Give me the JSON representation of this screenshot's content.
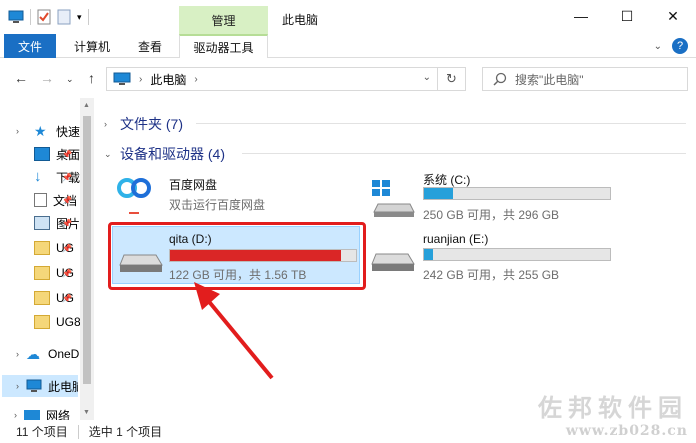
{
  "window": {
    "title": "此电脑",
    "context_tab_group": "管理"
  },
  "ribbon": {
    "tabs": [
      "文件",
      "计算机",
      "查看",
      "驱动器工具"
    ]
  },
  "address": {
    "crumb": "此电脑",
    "search_placeholder": "搜索\"此电脑\""
  },
  "nav": {
    "items": [
      {
        "label": "快速访问",
        "icon": "star-icon"
      },
      {
        "label": "桌面",
        "icon": "desktop-icon"
      },
      {
        "label": "下载",
        "icon": "download-icon"
      },
      {
        "label": "文档",
        "icon": "document-icon"
      },
      {
        "label": "图片",
        "icon": "pictures-icon"
      },
      {
        "label": "UG",
        "icon": "folder-icon"
      },
      {
        "label": "UG",
        "icon": "folder-icon"
      },
      {
        "label": "UG",
        "icon": "folder-icon"
      },
      {
        "label": "UG8",
        "icon": "folder-icon"
      },
      {
        "label": "OneDrive",
        "icon": "cloud-icon"
      },
      {
        "label": "此电脑",
        "icon": "computer-icon"
      },
      {
        "label": "网络",
        "icon": "network-icon"
      }
    ]
  },
  "content": {
    "folders_group": "文件夹 (7)",
    "devices_group": "设备和驱动器 (4)",
    "baidu": {
      "name": "百度网盘",
      "sub": "双击运行百度网盘"
    },
    "drives": [
      {
        "name": "系统 (C:)",
        "info": "250 GB 可用，共 296 GB",
        "used_fraction": 0.155,
        "color": "#26a0da"
      },
      {
        "name": "qita (D:)",
        "info": "122 GB 可用，共 1.56 TB",
        "used_fraction": 0.92,
        "color": "#da2626"
      },
      {
        "name": "ruanjian (E:)",
        "info": "242 GB 可用，共 255 GB",
        "used_fraction": 0.05,
        "color": "#26a0da"
      }
    ]
  },
  "status": {
    "items": "11 个项目",
    "selected": "选中 1 个项目"
  },
  "watermark": {
    "big": "佐邦软件园",
    "small": "www.zb028.cn"
  }
}
